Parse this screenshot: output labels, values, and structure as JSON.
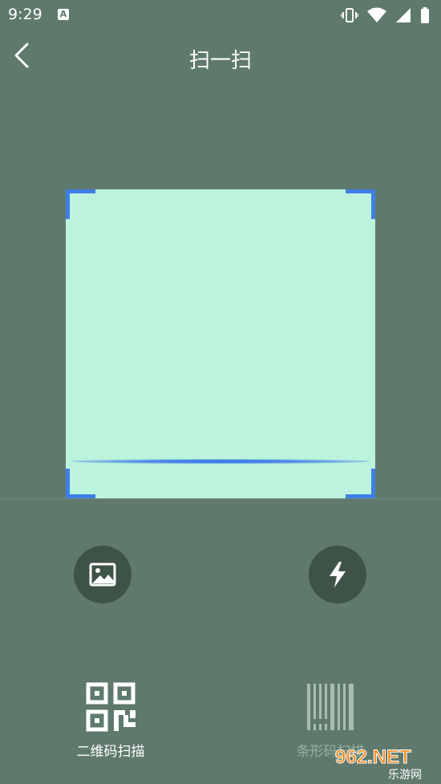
{
  "status_bar": {
    "time": "9:29",
    "notification_letter": "A"
  },
  "header": {
    "title": "扫一扫"
  },
  "scan_modes": [
    {
      "label": "二维码扫描",
      "active": true
    },
    {
      "label": "条形码扫描",
      "active": false
    }
  ],
  "watermark": {
    "logo_text": "962.NET",
    "site_name": "乐游网"
  },
  "colors": {
    "background": "#5f7a6d",
    "scan_area": "#bcf3dc",
    "corner_accent": "#3e7fe6",
    "button_bg": "#3f5248",
    "inactive_label": "#9bb0a5"
  },
  "icons": {
    "back": "chevron-left-icon",
    "gallery": "image-icon",
    "flash": "flash-icon",
    "qr": "qr-code-icon",
    "barcode": "barcode-icon"
  }
}
